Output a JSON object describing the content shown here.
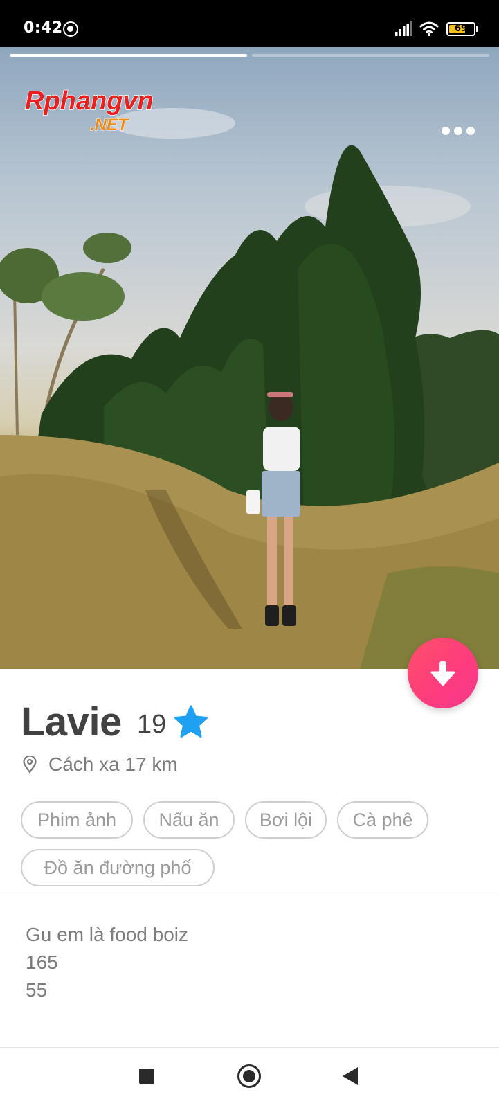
{
  "status_bar": {
    "time": "0:42",
    "battery_level": "69",
    "battery_color": "#f2c21b"
  },
  "photo": {
    "photo_count": 2,
    "current_photo": 1,
    "watermark_text": "Rphangvn",
    "watermark_subtext": ".NET",
    "more_icon": "more-horizontal-icon"
  },
  "actions": {
    "down_button_icon": "arrow-down-icon",
    "down_button_color": "#fd5068"
  },
  "profile": {
    "name": "Lavie",
    "age": "19",
    "verified_icon": "star-icon",
    "verified_color": "#1ea1f2",
    "location_icon": "location-pin-icon",
    "distance": "Cách xa 17 km",
    "interests": [
      "Phim ảnh",
      "Nấu ăn",
      "Bơi lội",
      "Cà phê",
      "Đồ ăn đường phố"
    ],
    "bio_lines": [
      "Gu em là food boiz",
      "165",
      "55"
    ]
  },
  "nav": {
    "recents_icon": "square-icon",
    "home_icon": "circle-icon",
    "back_icon": "triangle-back-icon"
  }
}
